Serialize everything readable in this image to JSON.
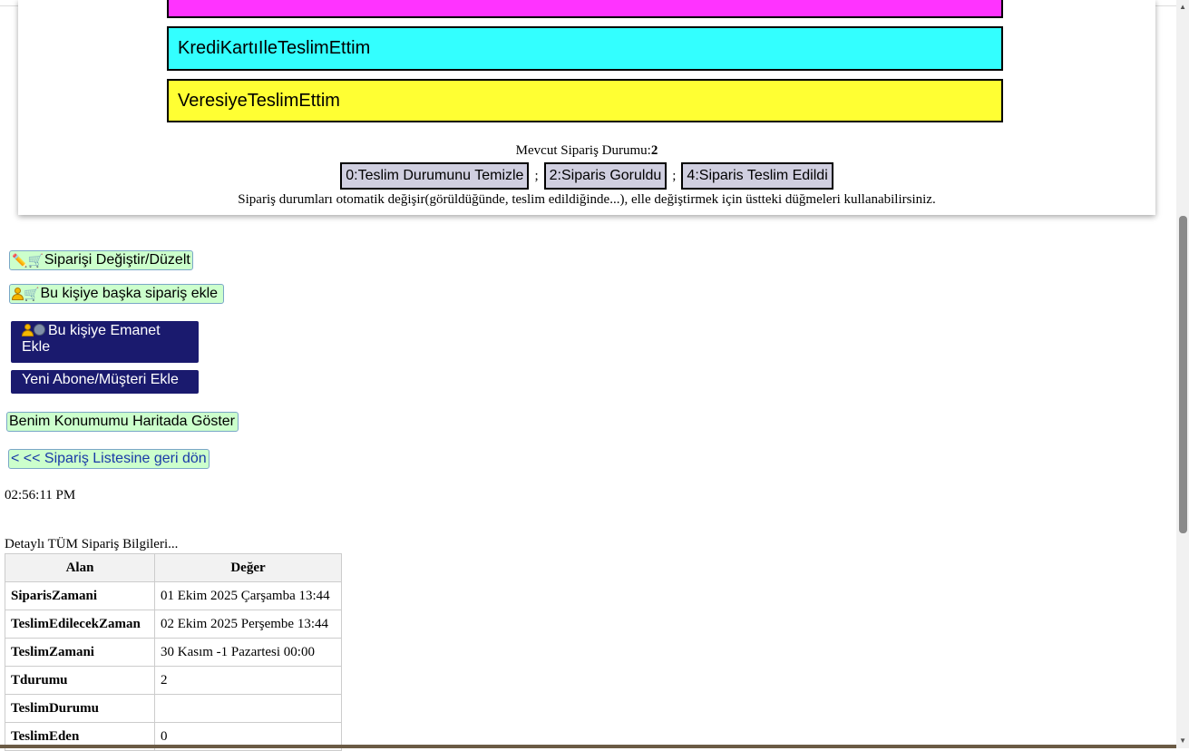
{
  "status_buttons": {
    "cyan_label": "KrediKartıIleTeslimEttim",
    "yellow_label": "VeresiyeTeslimEttim"
  },
  "order_state": {
    "current_label": "Mevcut Sipariş Durumu:",
    "current_value": "2",
    "btn_clear": "0:Teslim Durumunu Temizle",
    "btn_seen": "2:Siparis Goruldu",
    "btn_delivered": "4:Siparis Teslim Edildi",
    "separator": ";",
    "note": "Sipariş durumları otomatik değişir(görüldüğünde, teslim edildiğinde...), elle değiştirmek için üstteki düğmeleri kullanabilirsiniz."
  },
  "actions": {
    "edit_order": "Siparişi Değiştir/Düzelt",
    "add_order": "Bu kişiye başka sipariş ekle",
    "add_deposit": "Bu kişiye Emanet Ekle",
    "new_customer": "Yeni Abone/Müşteri Ekle",
    "show_location": "Benim Konumumu Haritada Göster",
    "back_to_list": "< << Sipariş Listesine geri dön"
  },
  "time": "02:56:11 PM",
  "details": {
    "caption": "Detaylı TÜM Sipariş Bilgileri...",
    "headers": [
      "Alan",
      "Değer"
    ],
    "rows": [
      {
        "key": "SiparisZamani",
        "value": "01 Ekim 2025 Çarşamba 13:44"
      },
      {
        "key": "TeslimEdilecekZaman",
        "value": "02 Ekim 2025 Perşembe 13:44"
      },
      {
        "key": "TeslimZamani",
        "value": "30 Kasım -1 Pazartesi 00:00"
      },
      {
        "key": "Tdurumu",
        "value": "2"
      },
      {
        "key": "TeslimDurumu",
        "value": ""
      },
      {
        "key": "TeslimEden",
        "value": "0"
      }
    ]
  },
  "colors": {
    "magenta": "#ff33ff",
    "cyan": "#33ffff",
    "yellow": "#ffff33",
    "navy": "#1a1a6e",
    "green_button": "#ccffcc"
  },
  "icons": [
    "pencil-icon",
    "cart-icon",
    "person-icon",
    "coin-icon"
  ]
}
